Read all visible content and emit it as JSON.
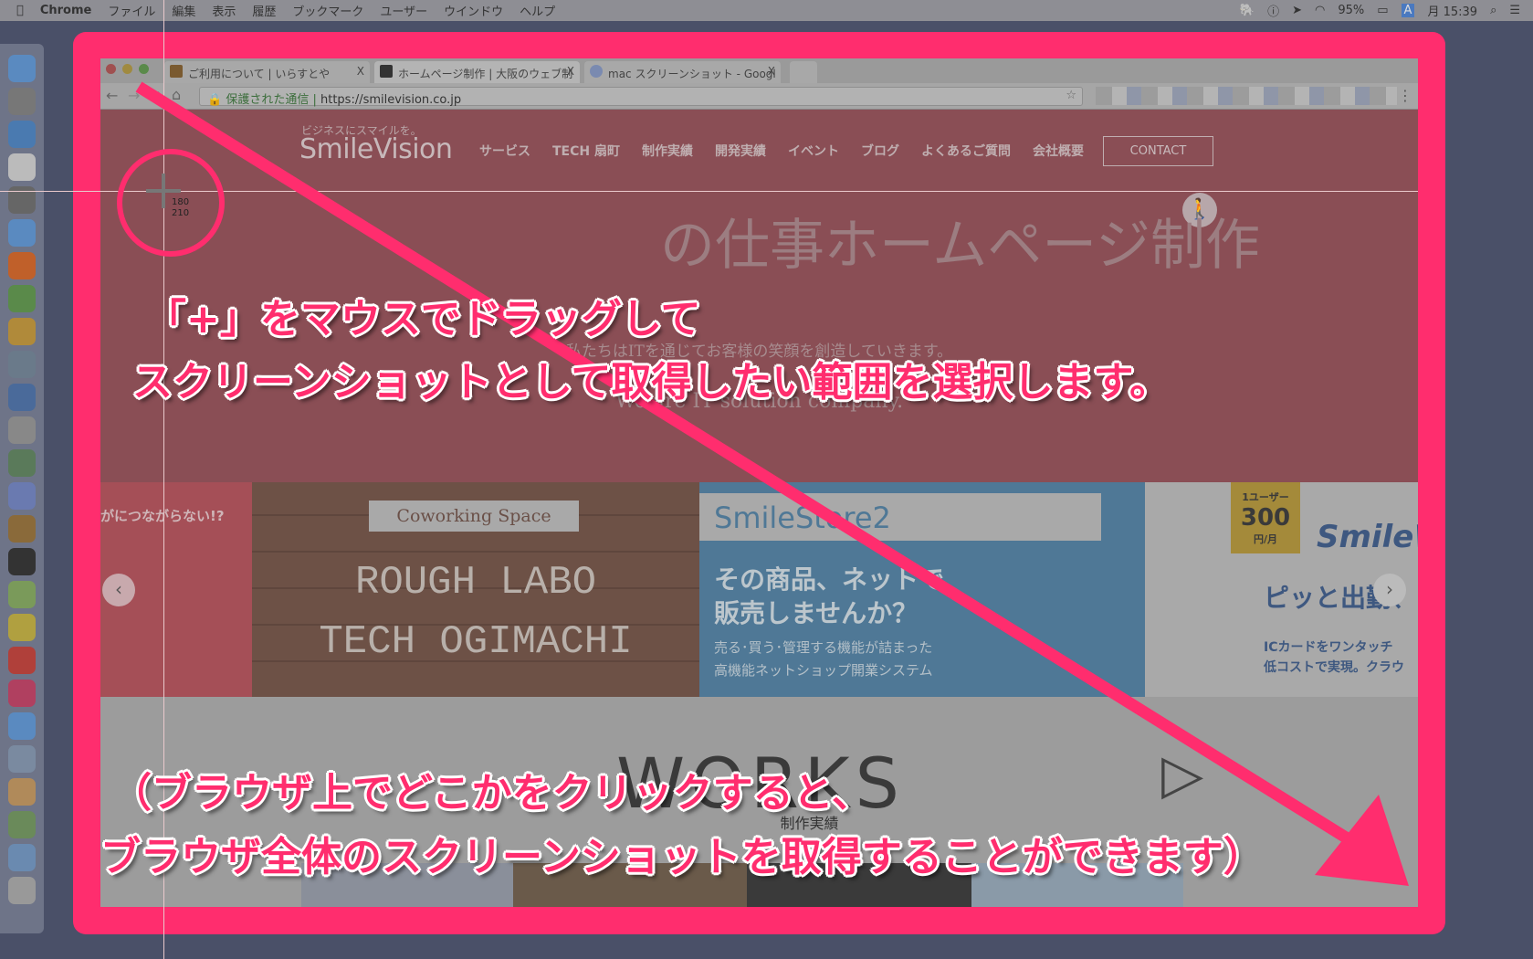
{
  "menubar": {
    "apple": "",
    "app": "Chrome",
    "items": [
      "ファイル",
      "編集",
      "表示",
      "履歴",
      "ブックマーク",
      "ユーザー",
      "ウインドウ",
      "ヘルプ"
    ],
    "battery": "95%",
    "clock": "月 15:39",
    "input_mode": "A"
  },
  "browser": {
    "tabs": [
      {
        "title": "ご利用について | いらすとや",
        "close": "X"
      },
      {
        "title": "ホームページ制作 | 大阪のウェブ制",
        "close": "X"
      },
      {
        "title": "mac スクリーンショット - Googl",
        "close": "X"
      }
    ],
    "secure_label": "保護された通信",
    "url": "https://smilevision.co.jp"
  },
  "site": {
    "logo_tagline": "ビジネスにスマイルを。",
    "logo": "SmileVision",
    "nav": [
      "サービス",
      "TECH 扇町",
      "制作実績",
      "開発実績",
      "イベント",
      "ブログ",
      "よくあるご質問",
      "会社概要"
    ],
    "contact": "CONTACT",
    "hero_title": "の仕事ホームページ制作",
    "hero_sub": "私たちはITを通じてお客様の笑顔を創造していきます。",
    "hero_en": "We are IT solution company.",
    "banners": {
      "b1": "がにつながらない!?",
      "b2_label": "Coworking Space",
      "b2_line1": "ROUGH LABO",
      "b2_line2": "TECH OGIMACHI",
      "b3_title": "SmileStore2",
      "b3_line1": "その商品、ネットで",
      "b3_line2": "販売しませんか？",
      "b3_sub1": "売る･買う･管理する機能が詰まった",
      "b3_sub2": "高機能ネットショップ開業システム",
      "b4_badge1": "1ユーザー",
      "b4_price": "300",
      "b4_unit": "円/月",
      "b4_title": "SmileW",
      "b4_line": "ピッと出勤、",
      "b4_sub1": "ICカードをワンタッチ",
      "b4_sub2": "低コストで実現。クラウ"
    },
    "works_title": "WORKS",
    "works_sub": "制作実績"
  },
  "overlay": {
    "cursor_x": "180",
    "cursor_y": "210",
    "caption1": "「+」をマウスでドラッグして",
    "caption2": "スクリーンショットとして取得したい範囲を選択します。",
    "caption3": "（ブラウザ上でどこかをクリックすると、",
    "caption4": "ブラウザ全体のスクリーンショットを取得することができます）",
    "accent": "#ff2d6e"
  }
}
